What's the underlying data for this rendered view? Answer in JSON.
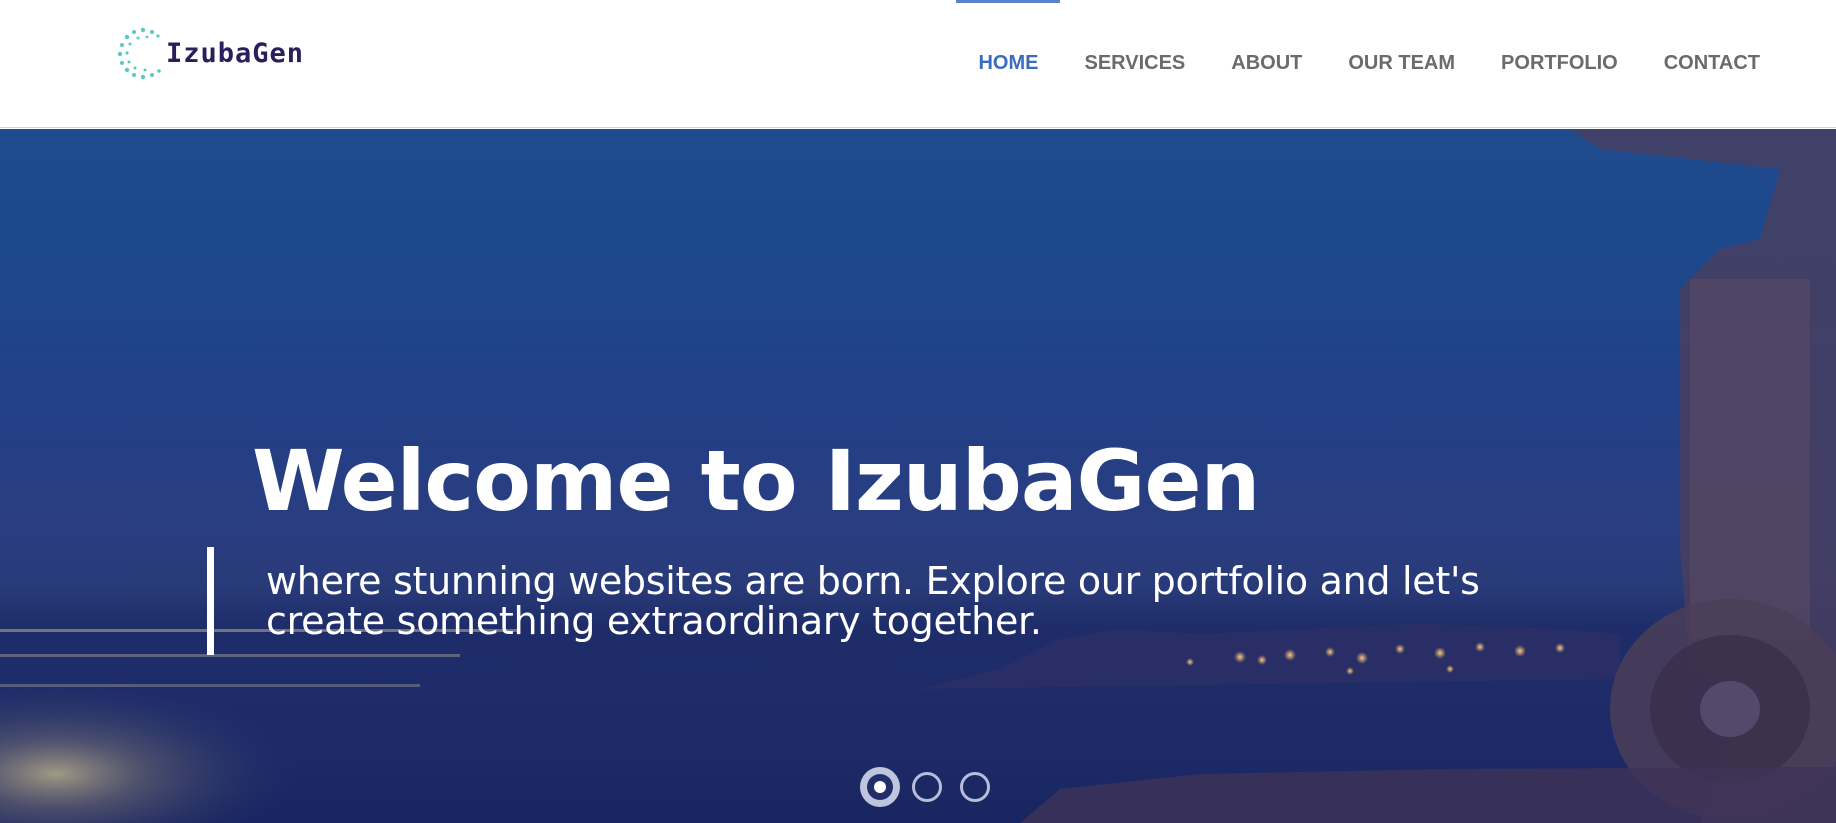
{
  "brand": {
    "name": "IzubaGen",
    "accent_color": "#3d6bc0",
    "logo_text_color": "#27205c"
  },
  "nav": {
    "items": [
      {
        "label": "HOME",
        "active": true
      },
      {
        "label": "SERVICES",
        "active": false
      },
      {
        "label": "ABOUT",
        "active": false
      },
      {
        "label": "OUR TEAM",
        "active": false
      },
      {
        "label": "PORTFOLIO",
        "active": false
      },
      {
        "label": "CONTACT",
        "active": false
      }
    ]
  },
  "hero": {
    "title": "Welcome to IzubaGen",
    "subtitle": "where stunning websites are born. Explore our portfolio and let's create something extraordinary together.",
    "slides": {
      "count": 3,
      "active_index": 1
    }
  }
}
